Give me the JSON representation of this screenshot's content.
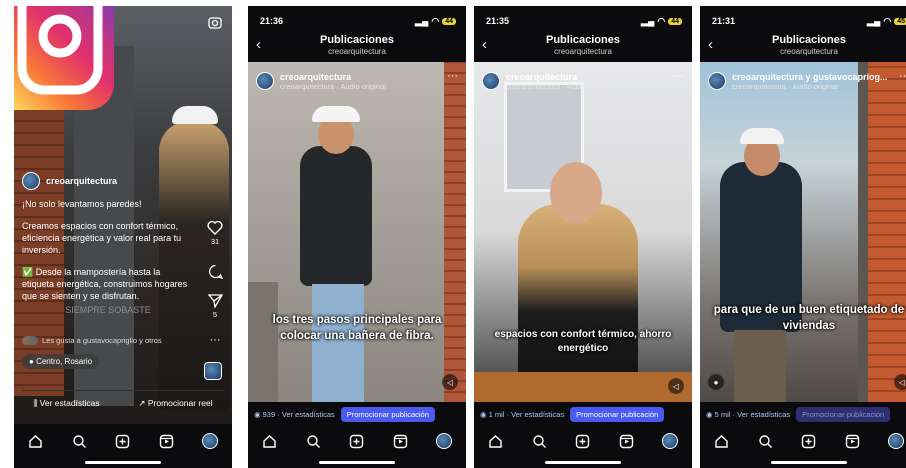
{
  "phone1": {
    "username": "creoarquitectura",
    "caption_lines": [
      "¡No solo levantamos paredes!",
      "Creamos espacios con confort térmico, eficiencia energética y valor real para tu inversión.",
      "✅ Desde la mampostería hasta la etiqueta energética, construimos hogares que se sienten y se disfrutan."
    ],
    "likes_text": "Les gusta a gustavocapriglio y otros",
    "location": "Centro, Rosario",
    "stats_label": "Ver estadísticas",
    "promote_label": "Promocionar reel",
    "like_count": "31",
    "share_count": "5",
    "overlay_text": "SIEMPRE SOBASTE"
  },
  "phone2": {
    "time": "21:36",
    "battery": "44",
    "title": "Publicaciones",
    "subtitle": "creoarquitectura",
    "username": "creoarquitectura",
    "audio": "creoarquitectura · Audio original",
    "caption": "los tres pasos principales para colocar una bañera de fibra.",
    "views": "939 · Ver estadísticas",
    "promote": "Promocionar publicación"
  },
  "phone3": {
    "time": "21:35",
    "battery": "44",
    "title": "Publicaciones",
    "subtitle": "creoarquitectura",
    "username": "creoarquitectura",
    "audio": "creoarquitectura · Audio original",
    "caption": "espacios con confort térmico, ahorro energético",
    "views": "1 mil · Ver estadísticas",
    "promote": "Promocionar publicación"
  },
  "phone4": {
    "time": "21:31",
    "battery": "45",
    "title": "Publicaciones",
    "subtitle": "creoarquitectura",
    "username": "creoarquitectura y gustavocapriog...",
    "audio": "creoarquitectura · Audio original",
    "caption": "para que de un buen etiquetado de viviendas",
    "views": "5 mil · Ver estadísticas",
    "promote": "Promocionar publicación"
  },
  "icons": [
    "instagram-logo",
    "camera-icon",
    "heart-icon",
    "comment-icon",
    "share-icon",
    "home-icon",
    "search-icon",
    "create-icon",
    "reels-icon",
    "profile-icon",
    "back-icon",
    "more-icon",
    "mute-icon"
  ],
  "colors": {
    "accent": "#4a5af0",
    "link": "#a9c8f5",
    "background": "#0b0b0d"
  }
}
